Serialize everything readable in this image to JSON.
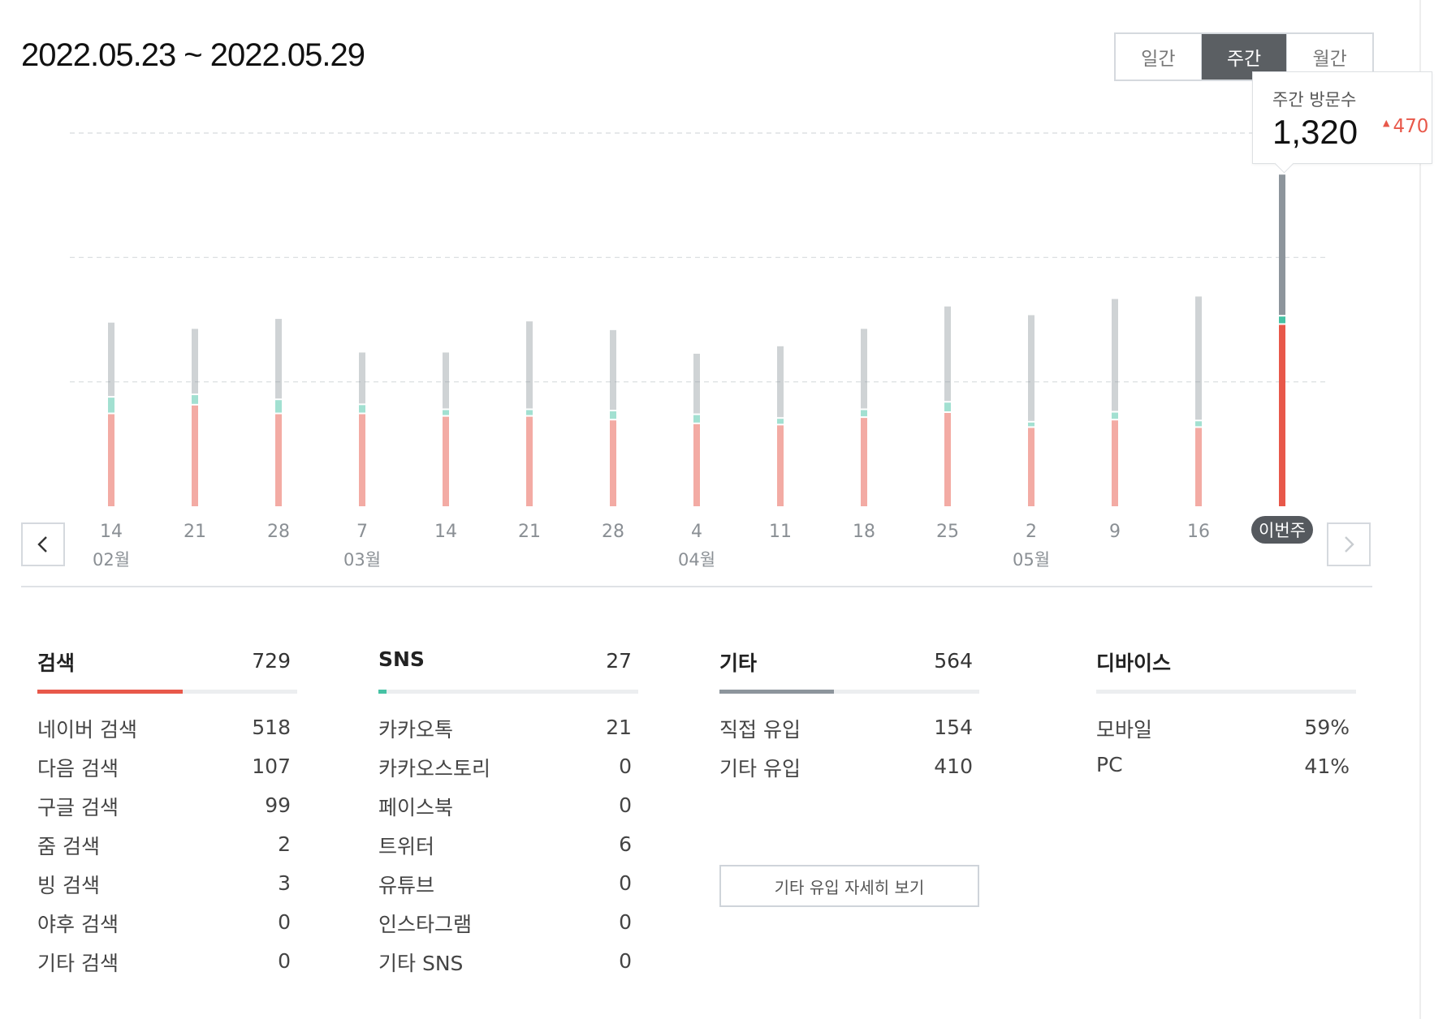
{
  "header": {
    "date_range": "2022.05.23 ~ 2022.05.29",
    "period_tabs": [
      "일간",
      "주간",
      "월간"
    ],
    "active_tab": "주간"
  },
  "tooltip": {
    "label": "주간 방문수",
    "value": "1,320",
    "delta": "470"
  },
  "colors": {
    "search": "#e8584a",
    "sns": "#46c2a4",
    "other": "#8d959c",
    "grid": "#d8dbde",
    "axis_text": "#8a8f94",
    "badge_bg": "#55595e"
  },
  "chart_data": {
    "type": "bar",
    "stacked": true,
    "categories": [
      "14",
      "21",
      "28",
      "7",
      "14",
      "21",
      "28",
      "4",
      "11",
      "18",
      "25",
      "2",
      "9",
      "16",
      "이번주"
    ],
    "month_labels": [
      {
        "label": "02월",
        "at_index": 0
      },
      {
        "label": "03월",
        "at_index": 3
      },
      {
        "label": "04월",
        "at_index": 7
      },
      {
        "label": "05월",
        "at_index": 11
      }
    ],
    "highlighted_index": 14,
    "series": [
      {
        "name": "검색",
        "values": [
          370,
          405,
          370,
          370,
          360,
          360,
          345,
          330,
          325,
          355,
          375,
          315,
          345,
          315,
          729
        ]
      },
      {
        "name": "SNS",
        "values": [
          60,
          35,
          50,
          30,
          20,
          20,
          30,
          30,
          20,
          25,
          35,
          15,
          25,
          20,
          27
        ]
      },
      {
        "name": "기타",
        "values": [
          295,
          260,
          320,
          205,
          225,
          350,
          320,
          240,
          285,
          320,
          380,
          425,
          450,
          495,
          564
        ]
      }
    ],
    "ylim": [
      0,
      1500
    ],
    "gridlines": [
      500,
      1000,
      1500
    ],
    "grid": true
  },
  "nav": {
    "prev_icon": "chevron-left-icon",
    "next_icon": "chevron-right-icon"
  },
  "stats": [
    {
      "title": "검색",
      "total": "729",
      "share": 0.56,
      "color": "#e8584a",
      "rows": [
        {
          "label": "네이버 검색",
          "value": "518"
        },
        {
          "label": "다음 검색",
          "value": "107"
        },
        {
          "label": "구글 검색",
          "value": "99"
        },
        {
          "label": "줌 검색",
          "value": "2"
        },
        {
          "label": "빙 검색",
          "value": "3"
        },
        {
          "label": "야후 검색",
          "value": "0"
        },
        {
          "label": "기타 검색",
          "value": "0"
        }
      ]
    },
    {
      "title": "SNS",
      "total": "27",
      "share": 0.03,
      "color": "#46c2a4",
      "rows": [
        {
          "label": "카카오톡",
          "value": "21"
        },
        {
          "label": "카카오스토리",
          "value": "0"
        },
        {
          "label": "페이스북",
          "value": "0"
        },
        {
          "label": "트위터",
          "value": "6"
        },
        {
          "label": "유튜브",
          "value": "0"
        },
        {
          "label": "인스타그램",
          "value": "0"
        },
        {
          "label": "기타 SNS",
          "value": "0"
        }
      ]
    },
    {
      "title": "기타",
      "total": "564",
      "share": 0.44,
      "color": "#8d959c",
      "rows": [
        {
          "label": "직접 유입",
          "value": "154"
        },
        {
          "label": "기타 유입",
          "value": "410"
        }
      ],
      "button": "기타 유입 자세히 보기"
    },
    {
      "title": "디바이스",
      "total": "",
      "rows": [
        {
          "label": "모바일",
          "value": "59%"
        },
        {
          "label": "PC",
          "value": "41%"
        }
      ]
    }
  ]
}
